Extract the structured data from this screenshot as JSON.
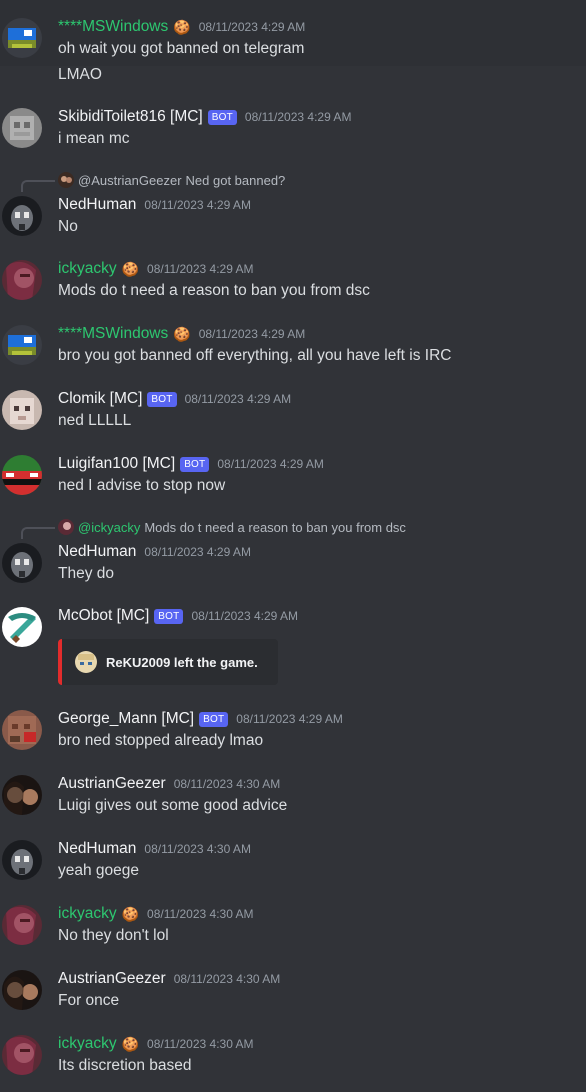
{
  "messages": [
    {
      "user": "****MSWindows",
      "emoji": "🍪",
      "ts": "08/11/2023 4:29 AM",
      "lines": [
        "oh wait you got banned on telegram",
        "LMAO"
      ]
    },
    {
      "user": "SkibidiToilet816 [MC]",
      "badge": "BOT",
      "ts": "08/11/2023 4:29 AM",
      "lines": [
        "i mean mc"
      ]
    },
    {
      "reply_to": "@AustrianGeezer",
      "reply_text": "Ned got banned?",
      "user": "NedHuman",
      "ts": "08/11/2023 4:29 AM",
      "lines": [
        "No"
      ]
    },
    {
      "user": "ickyacky",
      "emoji": "🍪",
      "ts": "08/11/2023 4:29 AM",
      "lines": [
        "Mods do t need a reason to ban you from dsc"
      ]
    },
    {
      "user": "****MSWindows",
      "emoji": "🍪",
      "ts": "08/11/2023 4:29 AM",
      "lines": [
        "bro you got banned off everything, all you have left is IRC"
      ]
    },
    {
      "user": "Clomik [MC]",
      "badge": "BOT",
      "ts": "08/11/2023 4:29 AM",
      "lines": [
        "ned LLLLL"
      ]
    },
    {
      "user": "Luigifan100 [MC]",
      "badge": "BOT",
      "ts": "08/11/2023 4:29 AM",
      "lines": [
        "ned I advise to stop now"
      ]
    },
    {
      "reply_to": "@ickyacky",
      "reply_text": "Mods do t need a reason to ban you from dsc",
      "user": "NedHuman",
      "ts": "08/11/2023 4:29 AM",
      "lines": [
        "They do"
      ]
    },
    {
      "user": "McObot [MC]",
      "badge": "BOT",
      "ts": "08/11/2023 4:29 AM",
      "embed": "ReKU2009 left the game."
    },
    {
      "user": "George_Mann [MC]",
      "badge": "BOT",
      "ts": "08/11/2023 4:29 AM",
      "lines": [
        "bro ned stopped already lmao"
      ]
    },
    {
      "user": "AustrianGeezer",
      "ts": "08/11/2023 4:30 AM",
      "lines": [
        "Luigi gives out some good advice"
      ]
    },
    {
      "user": "NedHuman",
      "ts": "08/11/2023 4:30 AM",
      "lines": [
        "yeah goege"
      ]
    },
    {
      "user": "ickyacky",
      "emoji": "🍪",
      "ts": "08/11/2023 4:30 AM",
      "lines": [
        "No they don't lol"
      ]
    },
    {
      "user": "AustrianGeezer",
      "ts": "08/11/2023 4:30 AM",
      "lines": [
        "For once"
      ]
    },
    {
      "user": "ickyacky",
      "emoji": "🍪",
      "ts": "08/11/2023 4:30 AM",
      "lines": [
        "Its discretion based"
      ]
    }
  ],
  "colors": {
    "background": "#313338",
    "role_green": "#2dc770",
    "bot_badge": "#5865f2",
    "embed_bar": "#e22c2c"
  }
}
